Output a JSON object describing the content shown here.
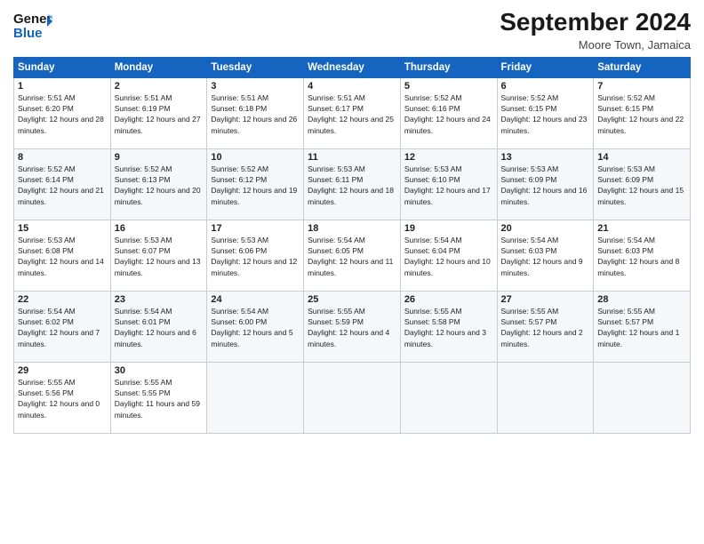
{
  "logo": {
    "line1": "General",
    "line2": "Blue"
  },
  "title": "September 2024",
  "location": "Moore Town, Jamaica",
  "days_header": [
    "Sunday",
    "Monday",
    "Tuesday",
    "Wednesday",
    "Thursday",
    "Friday",
    "Saturday"
  ],
  "weeks": [
    [
      {
        "day": "1",
        "sunrise": "5:51 AM",
        "sunset": "6:20 PM",
        "daylight": "12 hours and 28 minutes."
      },
      {
        "day": "2",
        "sunrise": "5:51 AM",
        "sunset": "6:19 PM",
        "daylight": "12 hours and 27 minutes."
      },
      {
        "day": "3",
        "sunrise": "5:51 AM",
        "sunset": "6:18 PM",
        "daylight": "12 hours and 26 minutes."
      },
      {
        "day": "4",
        "sunrise": "5:51 AM",
        "sunset": "6:17 PM",
        "daylight": "12 hours and 25 minutes."
      },
      {
        "day": "5",
        "sunrise": "5:52 AM",
        "sunset": "6:16 PM",
        "daylight": "12 hours and 24 minutes."
      },
      {
        "day": "6",
        "sunrise": "5:52 AM",
        "sunset": "6:15 PM",
        "daylight": "12 hours and 23 minutes."
      },
      {
        "day": "7",
        "sunrise": "5:52 AM",
        "sunset": "6:15 PM",
        "daylight": "12 hours and 22 minutes."
      }
    ],
    [
      {
        "day": "8",
        "sunrise": "5:52 AM",
        "sunset": "6:14 PM",
        "daylight": "12 hours and 21 minutes."
      },
      {
        "day": "9",
        "sunrise": "5:52 AM",
        "sunset": "6:13 PM",
        "daylight": "12 hours and 20 minutes."
      },
      {
        "day": "10",
        "sunrise": "5:52 AM",
        "sunset": "6:12 PM",
        "daylight": "12 hours and 19 minutes."
      },
      {
        "day": "11",
        "sunrise": "5:53 AM",
        "sunset": "6:11 PM",
        "daylight": "12 hours and 18 minutes."
      },
      {
        "day": "12",
        "sunrise": "5:53 AM",
        "sunset": "6:10 PM",
        "daylight": "12 hours and 17 minutes."
      },
      {
        "day": "13",
        "sunrise": "5:53 AM",
        "sunset": "6:09 PM",
        "daylight": "12 hours and 16 minutes."
      },
      {
        "day": "14",
        "sunrise": "5:53 AM",
        "sunset": "6:09 PM",
        "daylight": "12 hours and 15 minutes."
      }
    ],
    [
      {
        "day": "15",
        "sunrise": "5:53 AM",
        "sunset": "6:08 PM",
        "daylight": "12 hours and 14 minutes."
      },
      {
        "day": "16",
        "sunrise": "5:53 AM",
        "sunset": "6:07 PM",
        "daylight": "12 hours and 13 minutes."
      },
      {
        "day": "17",
        "sunrise": "5:53 AM",
        "sunset": "6:06 PM",
        "daylight": "12 hours and 12 minutes."
      },
      {
        "day": "18",
        "sunrise": "5:54 AM",
        "sunset": "6:05 PM",
        "daylight": "12 hours and 11 minutes."
      },
      {
        "day": "19",
        "sunrise": "5:54 AM",
        "sunset": "6:04 PM",
        "daylight": "12 hours and 10 minutes."
      },
      {
        "day": "20",
        "sunrise": "5:54 AM",
        "sunset": "6:03 PM",
        "daylight": "12 hours and 9 minutes."
      },
      {
        "day": "21",
        "sunrise": "5:54 AM",
        "sunset": "6:03 PM",
        "daylight": "12 hours and 8 minutes."
      }
    ],
    [
      {
        "day": "22",
        "sunrise": "5:54 AM",
        "sunset": "6:02 PM",
        "daylight": "12 hours and 7 minutes."
      },
      {
        "day": "23",
        "sunrise": "5:54 AM",
        "sunset": "6:01 PM",
        "daylight": "12 hours and 6 minutes."
      },
      {
        "day": "24",
        "sunrise": "5:54 AM",
        "sunset": "6:00 PM",
        "daylight": "12 hours and 5 minutes."
      },
      {
        "day": "25",
        "sunrise": "5:55 AM",
        "sunset": "5:59 PM",
        "daylight": "12 hours and 4 minutes."
      },
      {
        "day": "26",
        "sunrise": "5:55 AM",
        "sunset": "5:58 PM",
        "daylight": "12 hours and 3 minutes."
      },
      {
        "day": "27",
        "sunrise": "5:55 AM",
        "sunset": "5:57 PM",
        "daylight": "12 hours and 2 minutes."
      },
      {
        "day": "28",
        "sunrise": "5:55 AM",
        "sunset": "5:57 PM",
        "daylight": "12 hours and 1 minute."
      }
    ],
    [
      {
        "day": "29",
        "sunrise": "5:55 AM",
        "sunset": "5:56 PM",
        "daylight": "12 hours and 0 minutes."
      },
      {
        "day": "30",
        "sunrise": "5:55 AM",
        "sunset": "5:55 PM",
        "daylight": "11 hours and 59 minutes."
      },
      null,
      null,
      null,
      null,
      null
    ]
  ],
  "labels": {
    "sunrise": "Sunrise:",
    "sunset": "Sunset:",
    "daylight": "Daylight:"
  }
}
